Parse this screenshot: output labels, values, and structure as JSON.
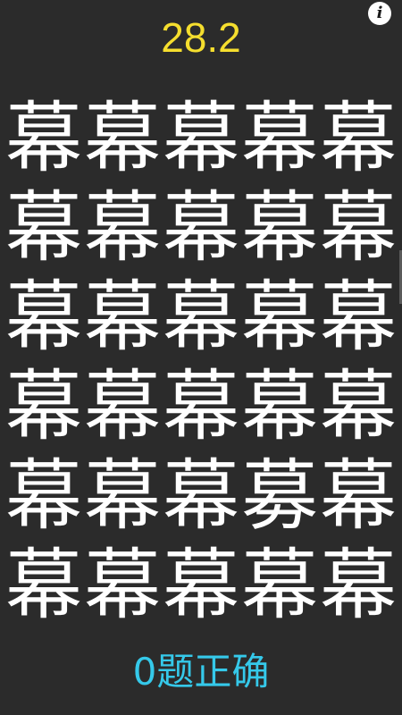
{
  "timer": "28.2",
  "info_label": "i",
  "grid": [
    "幕",
    "幕",
    "幕",
    "幕",
    "幕",
    "幕",
    "幕",
    "幕",
    "幕",
    "幕",
    "幕",
    "幕",
    "幕",
    "幕",
    "幕",
    "幕",
    "幕",
    "幕",
    "幕",
    "幕",
    "幕",
    "幕",
    "幕",
    "募",
    "幕",
    "幕",
    "幕",
    "幕",
    "幕",
    "幕"
  ],
  "score_text": "0题正确",
  "colors": {
    "background": "#2b2b2b",
    "timer": "#f5de2e",
    "characters": "#ffffff",
    "score": "#35c9ea"
  }
}
